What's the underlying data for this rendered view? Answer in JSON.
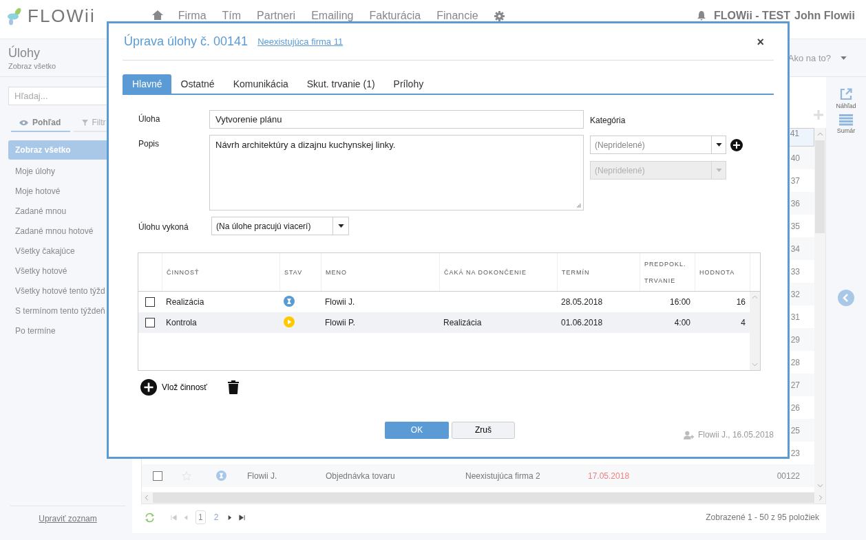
{
  "app": {
    "logo": "FLOWii",
    "nav": [
      "Firma",
      "Tím",
      "Partneri",
      "Emailing",
      "Fakturácia",
      "Financie"
    ],
    "account": "FLOWii - TEST",
    "user": "John Flowii"
  },
  "sidebar": {
    "title": "Úlohy",
    "subtitle": "Zobraz všetko",
    "search": {
      "placeholder": "Hľadaj..."
    },
    "tabs": [
      {
        "label": "Pohľad",
        "selected": true
      },
      {
        "label": "Filtr",
        "selected": false
      }
    ],
    "items": [
      {
        "label": "Zobraz všetko",
        "selected": true
      },
      {
        "label": "Moje úlohy",
        "selected": false
      },
      {
        "label": "Moje hotové",
        "selected": false
      },
      {
        "label": "Zadané mnou",
        "selected": false
      },
      {
        "label": "Zadané mnou hotové",
        "selected": false
      },
      {
        "label": "Všetky čakajúce",
        "selected": false
      },
      {
        "label": "Všetky hotové",
        "selected": false
      },
      {
        "label": "Všetky hotové tento týžd",
        "selected": false
      },
      {
        "label": "S termínom tento týždeň",
        "selected": false
      },
      {
        "label": "Po termíne",
        "selected": false
      }
    ],
    "footer_link": "Upraviť zoznam"
  },
  "help": "Ako na to?",
  "rail": [
    {
      "label": "Náhľad",
      "kind": "preview"
    },
    {
      "label": "Sumár",
      "kind": "summary"
    }
  ],
  "list": {
    "rows": [
      {
        "kind": "partial",
        "number": "41",
        "selected": true
      },
      {
        "kind": "partial",
        "number": "40",
        "selected": false
      },
      {
        "kind": "partial",
        "number": "37",
        "selected": false
      },
      {
        "kind": "partial",
        "number": "36",
        "selected": false
      },
      {
        "kind": "partial",
        "number": "35",
        "selected": false
      },
      {
        "kind": "partial",
        "number": "34",
        "selected": false
      },
      {
        "kind": "partial",
        "number": "33",
        "selected": false
      },
      {
        "kind": "partial",
        "number": "32",
        "selected": false
      },
      {
        "kind": "partial",
        "number": "31",
        "selected": false
      },
      {
        "kind": "partial",
        "number": "29",
        "selected": false
      },
      {
        "kind": "partial",
        "number": "28",
        "selected": false
      },
      {
        "kind": "partial",
        "number": "27",
        "selected": false
      },
      {
        "kind": "partial",
        "number": "26",
        "selected": false
      },
      {
        "kind": "partial",
        "number": "25",
        "selected": false
      },
      {
        "kind": "partial",
        "number": "23",
        "selected": false
      },
      {
        "kind": "full",
        "selected": false,
        "checked": false,
        "starred": false,
        "status": {
          "kind": "waiting"
        },
        "person": "Flowii J.",
        "subject": "Objednávka tovaru",
        "company": "Neexistujúca firma 2",
        "due": "17.05.2018",
        "overdue": true,
        "number": "00122"
      }
    ]
  },
  "pagination": {
    "pages": [
      {
        "label": "1",
        "selected": true
      },
      {
        "label": "2",
        "selected": false
      }
    ],
    "summary": "Zobrazené 1 - 50 z 95 položiek"
  },
  "dialog": {
    "title": "Úprava úlohy č. 00141",
    "company_link": "Neexistujúca firma 11",
    "close": "×",
    "tabs": [
      {
        "label": "Hlavné",
        "selected": true
      },
      {
        "label": "Ostatné",
        "selected": false
      },
      {
        "label": "Komunikácia",
        "selected": false
      },
      {
        "label": "Skut. trvanie (1)",
        "selected": false
      },
      {
        "label": "Prílohy",
        "selected": false
      }
    ],
    "task": {
      "label": "Úloha",
      "value": "Vytvorenie plánu"
    },
    "description": {
      "label": "Popis",
      "value": "Návrh architektúry a dizajnu kuchynskej linky."
    },
    "category": {
      "label": "Kategória",
      "selects": [
        {
          "placeholder": "(Nepridelené)",
          "disabled": false
        },
        {
          "placeholder": "(Nepridelené)",
          "disabled": true
        }
      ]
    },
    "assignee": {
      "label": "Úlohu vykoná",
      "value": "(Na úlohe pracujú viacerí)"
    },
    "activities": {
      "columns": [
        "ČINNOSŤ",
        "STAV",
        "MENO",
        "ČAKÁ NA DOKONČENIE",
        "TERMÍN",
        "PREDPOKL. TRVANIE",
        "HODNOTA"
      ],
      "rows": [
        {
          "checked": false,
          "name": "Realizácia",
          "status": {
            "kind": "waiting",
            "color": "#5b9bd5"
          },
          "person": "Flowii J.",
          "due": "28.05.2018",
          "duration": "16:00",
          "value": "16"
        },
        {
          "checked": false,
          "name": "Kontrola",
          "status": {
            "kind": "running",
            "color": "#ffc800"
          },
          "person": "Flowii P.",
          "waits_for": "Realizácia",
          "due": "01.06.2018",
          "duration": "4:00",
          "value": "4"
        }
      ]
    },
    "add_activity": "Vlož činnosť",
    "ok": "OK",
    "cancel": "Zruš",
    "created": "Flowii J., 16.05.2018"
  }
}
